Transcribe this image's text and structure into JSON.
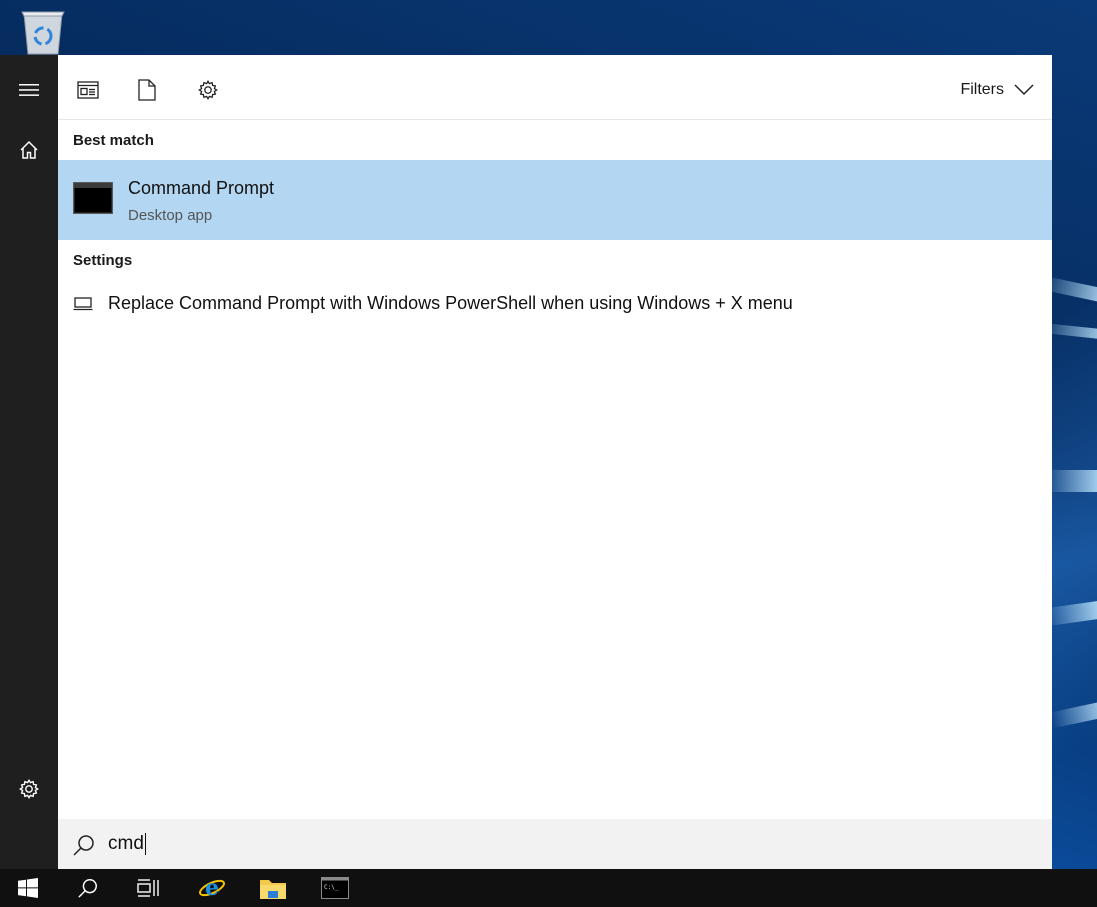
{
  "desktop": {
    "recycle_bin_icon": "recycle-bin-icon"
  },
  "rail": {
    "menu_icon": "hamburger-icon",
    "home_icon": "home-icon",
    "settings_icon": "gear-icon"
  },
  "toolbar": {
    "apps_icon": "apps-filter-icon",
    "documents_icon": "document-icon",
    "settings_icon": "gear-icon",
    "filters_label": "Filters"
  },
  "results": {
    "best_match_header": "Best match",
    "best_match": {
      "title": "Command Prompt",
      "subtitle": "Desktop app",
      "icon": "command-prompt-icon"
    },
    "settings_header": "Settings",
    "settings_items": [
      {
        "label": "Replace Command Prompt with Windows PowerShell when using Windows + X menu",
        "icon": "laptop-icon"
      }
    ]
  },
  "search": {
    "value": "cmd",
    "icon": "search-icon"
  },
  "taskbar": {
    "items": [
      "windows-start-icon",
      "search-icon",
      "task-view-icon",
      "internet-explorer-icon",
      "file-explorer-icon",
      "command-prompt-icon"
    ]
  },
  "colors": {
    "selection": "#b3d7f2",
    "rail": "#1f1f1f",
    "taskbar": "#101010",
    "search_bar": "#f2f2f2"
  }
}
